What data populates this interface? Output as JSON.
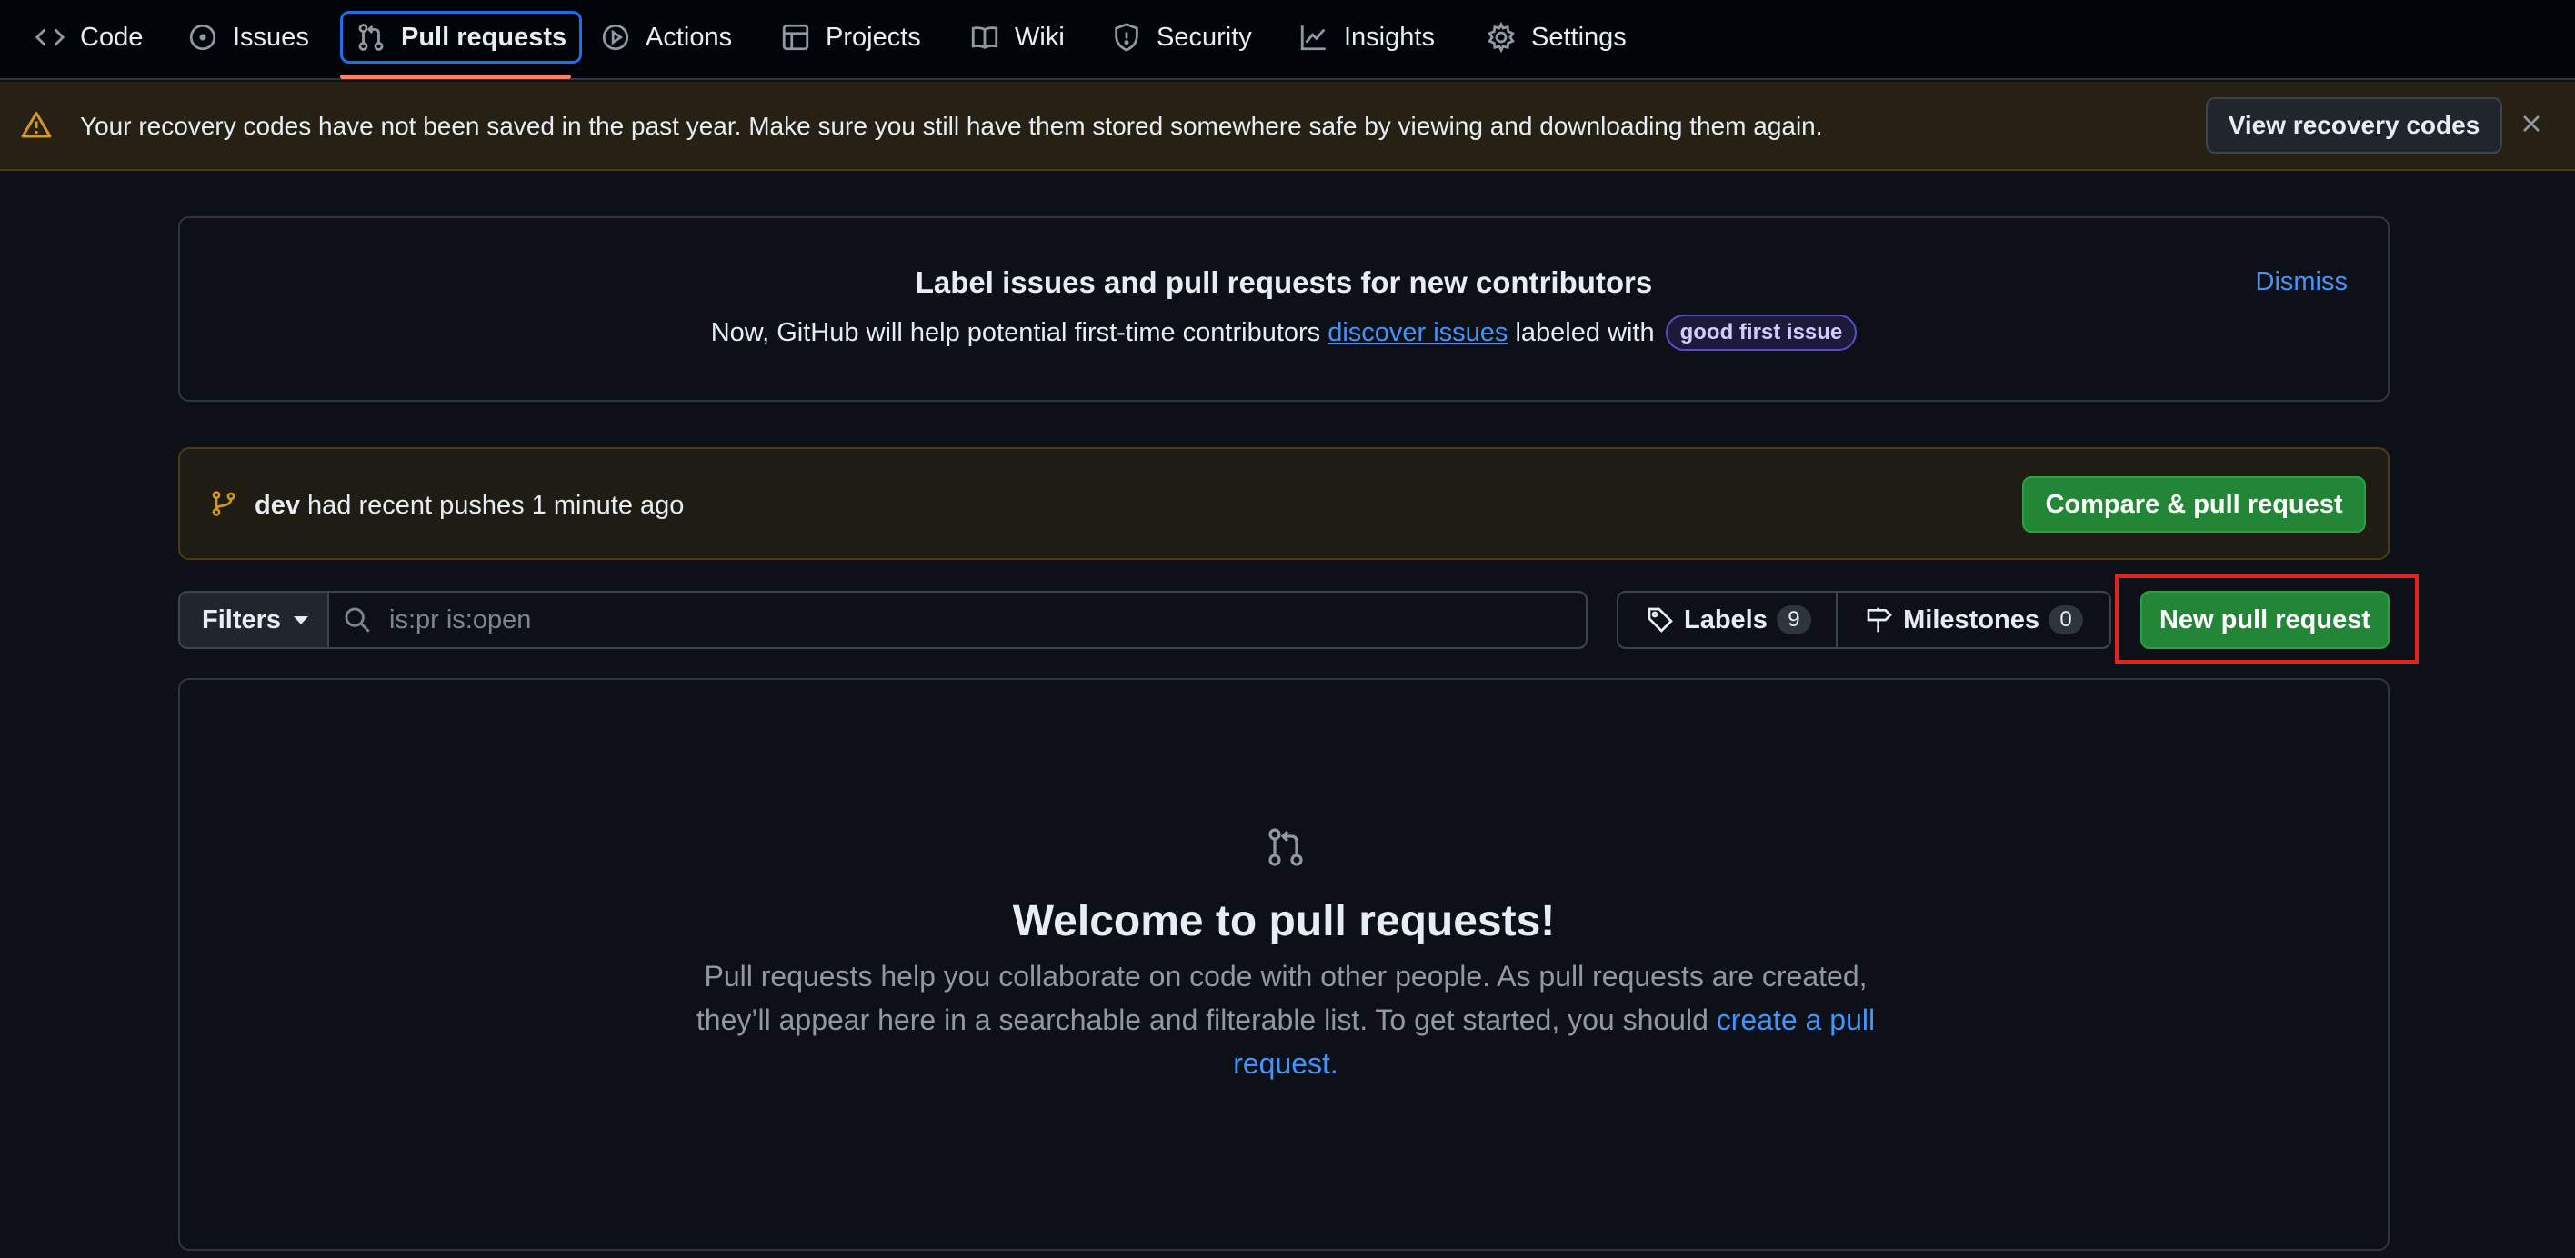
{
  "nav": {
    "tabs": [
      {
        "label": "Code",
        "icon": "code-icon"
      },
      {
        "label": "Issues",
        "icon": "issue-opened-icon"
      },
      {
        "label": "Pull requests",
        "icon": "git-pull-request-icon",
        "active": true
      },
      {
        "label": "Actions",
        "icon": "play-icon"
      },
      {
        "label": "Projects",
        "icon": "table-icon"
      },
      {
        "label": "Wiki",
        "icon": "book-icon"
      },
      {
        "label": "Security",
        "icon": "shield-icon"
      },
      {
        "label": "Insights",
        "icon": "graph-icon"
      },
      {
        "label": "Settings",
        "icon": "gear-icon"
      }
    ]
  },
  "recovery_banner": {
    "message": "Your recovery codes have not been saved in the past year. Make sure you still have them stored somewhere safe by viewing and downloading them again.",
    "button_label": "View recovery codes",
    "icon": "alert-icon"
  },
  "label_box": {
    "title": "Label issues and pull requests for new contributors",
    "text_before": "Now, GitHub will help potential first-time contributors",
    "link_text": "discover issues",
    "text_after": "labeled with",
    "badge": "good first issue",
    "dismiss_label": "Dismiss"
  },
  "recent_pushes": {
    "branch": "dev",
    "text": "had recent pushes 1 minute ago",
    "button_label": "Compare & pull request"
  },
  "filter_bar": {
    "filters_label": "Filters",
    "search_value": "is:pr is:open",
    "labels_label": "Labels",
    "labels_count": "9",
    "milestones_label": "Milestones",
    "milestones_count": "0",
    "new_pr_label": "New pull request"
  },
  "empty_state": {
    "heading": "Welcome to pull requests!",
    "body": "Pull requests help you collaborate on code with other people. As pull requests are created, they’ll appear here in a searchable and filterable list. To get started, you should",
    "link_text": "create a pull request."
  },
  "colors": {
    "background": "#0d1117",
    "accent_blue": "#4493f8",
    "green_button": "#238636",
    "active_tab_underline": "#f78166",
    "highlight_box": "#e5221b",
    "warning": "#d29922"
  }
}
